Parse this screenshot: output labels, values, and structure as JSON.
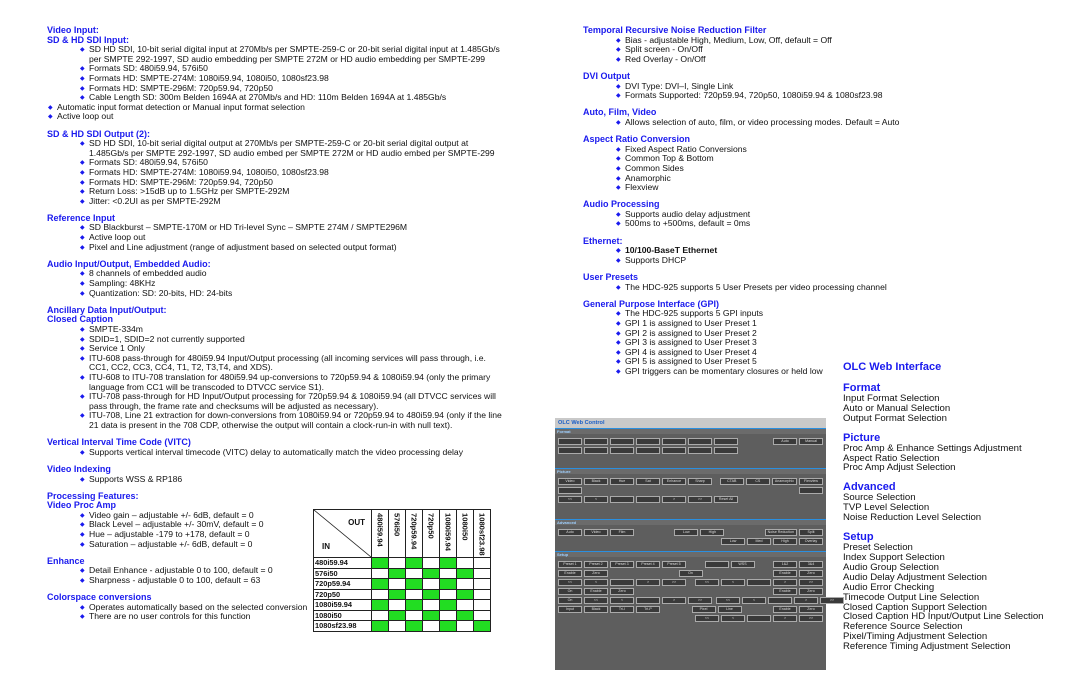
{
  "left_sections": [
    {
      "headings": [
        "Video Input:",
        "SD & HD SDI Input:"
      ],
      "items": [
        {
          "level": 1,
          "text": "SD HD SDI, 10-bit serial digital input at 270Mb/s per SMPTE-259-C or 20-bit serial digital input at 1.485Gb/s per SMPTE 292-1997, SD audio embedding per SMPTE 272M or HD audio embedding per SMPTE-299"
        },
        {
          "level": 1,
          "text": "Formats SD: 480i59.94, 576i50"
        },
        {
          "level": 1,
          "text": "Formats HD: SMPTE-274M: 1080i59.94, 1080i50, 1080sf23.98"
        },
        {
          "level": 1,
          "text": "Formats HD: SMPTE-296M: 720p59.94, 720p50"
        },
        {
          "level": 1,
          "text": "Cable Length SD: 300m Belden 1694A at 270Mb/s and HD: 110m  Belden 1694A at 1.485Gb/s"
        },
        {
          "level": 0,
          "text": "Automatic input format detection or Manual input format selection"
        },
        {
          "level": 0,
          "text": "Active loop out"
        }
      ]
    },
    {
      "headings": [
        "SD & HD SDI Output (2):"
      ],
      "items": [
        {
          "level": 1,
          "text": "SD HD SDI, 10-bit serial digital output at 270Mb/s per SMPTE-259-C or 20-bit serial digital output at 1.485Gb/s per SMPTE 292-1997, SD audio embed per SMPTE 272M or HD audio embed per SMPTE-299"
        },
        {
          "level": 1,
          "text": "Formats SD: 480i59.94, 576i50"
        },
        {
          "level": 1,
          "text": "Formats HD: SMPTE-274M: 1080i59.94, 1080i50, 1080sf23.98"
        },
        {
          "level": 1,
          "text": "Formats HD: SMPTE-296M: 720p59.94, 720p50"
        },
        {
          "level": 1,
          "text": "Return Loss: >15dB up to 1.5GHz per SMPTE-292M"
        },
        {
          "level": 1,
          "text": "Jitter: <0.2UI as per SMPTE-292M"
        }
      ]
    },
    {
      "headings": [
        "Reference Input"
      ],
      "items": [
        {
          "level": 1,
          "text": "SD Blackburst – SMPTE-170M or HD Tri-level Sync – SMPTE 274M / SMPTE296M"
        },
        {
          "level": 1,
          "text": "Active loop out"
        },
        {
          "level": 1,
          "text": "Pixel and Line adjustment (range of adjustment based on selected output format)"
        }
      ]
    },
    {
      "headings": [
        "Audio Input/Output, Embedded Audio:"
      ],
      "items": [
        {
          "level": 1,
          "text": "8 channels of embedded audio"
        },
        {
          "level": 1,
          "text": "Sampling: 48KHz"
        },
        {
          "level": 1,
          "text": "Quantization: SD: 20-bits, HD: 24-bits"
        }
      ]
    },
    {
      "headings": [
        "Ancillary Data Input/Output:",
        "Closed Caption"
      ],
      "items": [
        {
          "level": 1,
          "text": "SMPTE-334m"
        },
        {
          "level": 1,
          "text": "SDID=1, SDID=2 not currently supported"
        },
        {
          "level": 1,
          "text": "Service 1 Only"
        },
        {
          "level": 1,
          "text": "ITU-608 pass-through for 480i59.94 Input/Output processing (all incoming services will pass through, i.e. CC1, CC2, CC3, CC4, T1, T2, T3,T4, and XDS)."
        },
        {
          "level": 1,
          "text": "ITU-608 to ITU-708 translation for 480i59.94 up-conversions to 720p59.94 & 1080i59.94 (only the primary language from CC1 will be transcoded to DTVCC service S1)."
        },
        {
          "level": 1,
          "text": "ITU-708 pass-through for HD Input/Output processing for 720p59.94 & 1080i59.94 (all DTVCC services will pass through, the frame rate and checksums will be adjusted as necessary)."
        },
        {
          "level": 1,
          "text": "ITU-708, Line 21 extraction for down-conversions from 1080i59.94 or 720p59.94 to 480i59.94 (only if the line 21 data is present in the 708 CDP, otherwise the output will contain a clock-run-in with null text)."
        }
      ]
    },
    {
      "headings": [
        "Vertical Interval Time Code (VITC)"
      ],
      "items": [
        {
          "level": 1,
          "short": true,
          "text": "Supports vertical interval timecode (VITC) delay to automatically match the video processing delay"
        }
      ]
    },
    {
      "headings": [
        "Video Indexing"
      ],
      "items": [
        {
          "level": 1,
          "short": true,
          "text": "Supports WSS & RP186"
        }
      ]
    },
    {
      "headings": [
        "Processing Features:",
        "Video Proc Amp"
      ],
      "items": [
        {
          "level": 1,
          "short": true,
          "text": "Video gain – adjustable +/- 6dB, default = 0"
        },
        {
          "level": 1,
          "short": true,
          "text": "Black Level – adjustable +/- 30mV, default = 0"
        },
        {
          "level": 1,
          "short": true,
          "text": "Hue – adjustable -179 to +178, default = 0"
        },
        {
          "level": 1,
          "short": true,
          "text": "Saturation – adjustable +/- 6dB, default = 0"
        }
      ]
    },
    {
      "headings": [
        "Enhance"
      ],
      "items": [
        {
          "level": 1,
          "short": true,
          "text": "Detail Enhance - adjustable 0 to 100, default = 0"
        },
        {
          "level": 1,
          "short": true,
          "text": "Sharpness - adjustable 0 to 100, default = 63"
        }
      ]
    },
    {
      "headings": [
        "Colorspace conversions"
      ],
      "items": [
        {
          "level": 1,
          "short": true,
          "text": "Operates automatically based on the selected conversion"
        },
        {
          "level": 1,
          "short": true,
          "text": "There are no user controls for this function"
        }
      ]
    }
  ],
  "right_sections": [
    {
      "headings": [
        "Temporal Recursive Noise Reduction Filter"
      ],
      "items": [
        {
          "level": 1,
          "text": "Bias - adjustable High, Medium, Low, Off, default = Off"
        },
        {
          "level": 1,
          "text": "Split screen - On/Off"
        },
        {
          "level": 1,
          "text": "Red Overlay - On/Off"
        }
      ]
    },
    {
      "headings": [
        "DVI Output"
      ],
      "items": [
        {
          "level": 1,
          "text": "DVI Type: DVI–I, Single Link"
        },
        {
          "level": 1,
          "text": "Formats Supported: 720p59.94, 720p50, 1080i59.94 & 1080sf23.98"
        }
      ]
    },
    {
      "headings": [
        "Auto, Film, Video"
      ],
      "items": [
        {
          "level": 1,
          "text": "Allows selection of auto, film, or video processing modes. Default = Auto"
        }
      ]
    },
    {
      "headings": [
        "Aspect Ratio Conversion"
      ],
      "items": [
        {
          "level": 1,
          "text": "Fixed Aspect Ratio Conversions"
        },
        {
          "level": 1,
          "text": "Common Top & Bottom"
        },
        {
          "level": 1,
          "text": "Common Sides"
        },
        {
          "level": 1,
          "text": "Anamorphic"
        },
        {
          "level": 1,
          "text": "Flexview"
        }
      ]
    },
    {
      "headings": [
        "Audio Processing"
      ],
      "items": [
        {
          "level": 1,
          "text": "Supports audio delay adjustment"
        },
        {
          "level": 1,
          "text": "500ms to +500ms, default = 0ms"
        }
      ]
    },
    {
      "headings": [
        "Ethernet:"
      ],
      "items": [
        {
          "level": 1,
          "bold": true,
          "text": "10/100-BaseT Ethernet"
        },
        {
          "level": 1,
          "text": "Supports DHCP"
        }
      ]
    },
    {
      "headings": [
        "User Presets"
      ],
      "items": [
        {
          "level": 1,
          "text": "The HDC-925 supports 5 User Presets per video processing channel"
        }
      ]
    },
    {
      "headings": [
        "General Purpose Interface (GPI)"
      ],
      "items": [
        {
          "level": 1,
          "text": "The HDC-925 supports 5 GPI inputs"
        },
        {
          "level": 1,
          "text": "GPI 1 is assigned to User Preset 1"
        },
        {
          "level": 1,
          "text": "GPI 2 is assigned to User Preset 2"
        },
        {
          "level": 1,
          "text": "GPI 3 is assigned to User Preset 3"
        },
        {
          "level": 1,
          "text": "GPI 4 is assigned to User Preset 4"
        },
        {
          "level": 1,
          "text": "GPI 5 is assigned to User Preset 5"
        },
        {
          "level": 1,
          "text": "GPI triggers can be momentary closures or held low"
        }
      ]
    }
  ],
  "olc": {
    "title": "OLC Web Interface",
    "groups": [
      {
        "heading": "Format",
        "lines": [
          "Input Format Selection",
          "Auto or Manual Selection",
          "Output Format Selection"
        ]
      },
      {
        "heading": "Picture",
        "lines": [
          "Proc Amp & Enhance Settings Adjustment",
          "Aspect Ratio Selection",
          "Proc Amp Adjust Selection"
        ]
      },
      {
        "heading": "Advanced",
        "lines": [
          "Source Selection",
          "TVP Level Selection",
          "Noise Reduction Level Selection"
        ]
      },
      {
        "heading": "Setup",
        "lines": [
          "Preset Selection",
          "Index Support Selection",
          "Audio Group Selection",
          "Audio Delay Adjustment Selection",
          "Audio Error Checking",
          "Timecode Output Line Selection",
          "Closed Caption Support Selection",
          "Closed Caption HD Input/Output Line Selection",
          "Reference Source Selection",
          "Pixel/Timing Adjustment Selection",
          "Reference Timing Adjustment Selection"
        ]
      }
    ]
  },
  "matrix": {
    "out_label": "OUT",
    "in_label": "IN",
    "columns": [
      "480i59.94",
      "576i50",
      "720p59.94",
      "720p50",
      "1080i59.94",
      "1080i50",
      "1080sf23.98"
    ],
    "rows": [
      {
        "label": "480i59.94",
        "supported": [
          1,
          0,
          1,
          0,
          1,
          0,
          0
        ]
      },
      {
        "label": "576i50",
        "supported": [
          0,
          1,
          0,
          1,
          0,
          1,
          0
        ]
      },
      {
        "label": "720p59.94",
        "supported": [
          1,
          0,
          1,
          0,
          1,
          0,
          0
        ]
      },
      {
        "label": "720p50",
        "supported": [
          0,
          1,
          0,
          1,
          0,
          1,
          0
        ]
      },
      {
        "label": "1080i59.94",
        "supported": [
          1,
          0,
          1,
          0,
          1,
          0,
          0
        ]
      },
      {
        "label": "1080i50",
        "supported": [
          0,
          1,
          0,
          1,
          0,
          1,
          0
        ]
      },
      {
        "label": "1080sf23.98",
        "supported": [
          1,
          0,
          1,
          0,
          1,
          0,
          1
        ]
      }
    ],
    "supported_color": "#22dd22"
  },
  "web_control": {
    "title": "OLC Web Control",
    "sections": [
      {
        "name": "Format",
        "rows": [
          [
            "",
            "",
            "",
            "",
            "",
            "",
            "",
            "|",
            "Auto",
            "Manual"
          ],
          [
            "",
            "",
            "",
            "",
            "",
            "",
            ""
          ]
        ]
      },
      {
        "name": "Picture",
        "rows": [
          [
            "Video",
            "Black",
            "Hue",
            "Sat",
            "Enhance",
            "Sharp",
            "|",
            "CTAB",
            "CS",
            "Anamorphic",
            "Flexview"
          ],
          [
            "",
            "|",
            ""
          ],
          [
            "<<",
            "<",
            "",
            "",
            ">",
            ">>",
            "Reset All"
          ]
        ]
      },
      {
        "name": "Advanced",
        "rows": [
          [
            "Auto",
            "Video",
            "Film",
            "|",
            "Low",
            "High",
            "|",
            "Noise Reduction",
            "Split"
          ],
          [
            "|",
            "Low",
            "Med",
            "High",
            "Overlay"
          ]
        ]
      },
      {
        "name": "Setup",
        "rows": [
          [
            "Preset 1",
            "Preset 2",
            "Preset 3",
            "Preset 4",
            "Preset 5",
            "|",
            "",
            "WSS",
            "|",
            "1&2",
            "3&4"
          ],
          [
            "Enable",
            "Zero",
            "|",
            "On",
            "|",
            "Enable",
            "Zero"
          ],
          [
            "<<",
            "<",
            "",
            ">",
            ">>",
            "|",
            "<<",
            "<",
            "",
            ">",
            ">>"
          ],
          [
            "On",
            "Enable",
            "Zero",
            "|",
            "Enable",
            "Zero"
          ],
          [
            "On",
            "<<",
            "<",
            "",
            ">",
            ">>",
            "|",
            "<<",
            "<",
            "",
            ">",
            ">>"
          ],
          [
            "Input",
            "Black",
            "Tri-I",
            "Tri-P",
            "|",
            "Pixel",
            "Line",
            "|",
            "Enable",
            "Zero"
          ],
          [
            "|",
            "<<",
            "<",
            "",
            ">",
            ">>"
          ]
        ]
      }
    ]
  },
  "colors": {
    "heading": "#1a1aee",
    "bullet": "#1a1aee"
  }
}
